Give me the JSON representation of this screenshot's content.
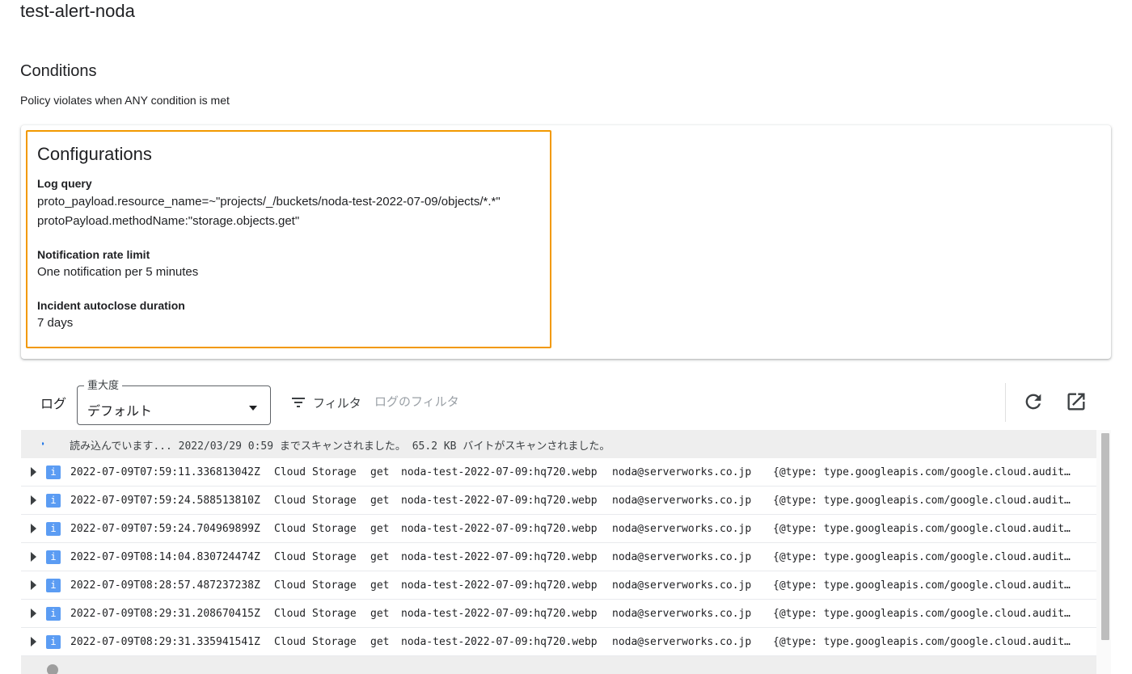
{
  "policy": {
    "title": "test-alert-noda"
  },
  "conditions": {
    "title": "Conditions",
    "description": "Policy violates when ANY condition is met",
    "config": {
      "heading": "Configurations",
      "log_query_label": "Log query",
      "log_query_line1": "proto_payload.resource_name=~\"projects/_/buckets/noda-test-2022-07-09/objects/*.*\"",
      "log_query_line2": "protoPayload.methodName:\"storage.objects.get\"",
      "rate_label": "Notification rate limit",
      "rate_value": "One notification per 5 minutes",
      "autoclose_label": "Incident autoclose duration",
      "autoclose_value": "7 days"
    }
  },
  "log_panel": {
    "label": "ログ",
    "severity_legend": "重大度",
    "severity_value": "デフォルト",
    "filter_label": "フィルタ",
    "filter_placeholder": "ログのフィルタ",
    "icons": {
      "filter": "filter-icon",
      "refresh": "refresh-icon",
      "open": "open-in-new-icon"
    },
    "loading_text": "読み込んでいます... 2022/03/29 0:59 までスキャンされました。 65.2 KB バイトがスキャンされました。",
    "rows": [
      {
        "severity": "i",
        "timestamp": "2022-07-09T07:59:11.336813042Z",
        "resource": "Cloud Storage",
        "method": "get",
        "object": "noda-test-2022-07-09:hq720.webp",
        "user": "noda@serverworks.co.jp",
        "payload": "{@type: type.googleapis.com/google.cloud.audit.AuditLog}"
      },
      {
        "severity": "i",
        "timestamp": "2022-07-09T07:59:24.588513810Z",
        "resource": "Cloud Storage",
        "method": "get",
        "object": "noda-test-2022-07-09:hq720.webp",
        "user": "noda@serverworks.co.jp",
        "payload": "{@type: type.googleapis.com/google.cloud.audit.AuditLog}"
      },
      {
        "severity": "i",
        "timestamp": "2022-07-09T07:59:24.704969899Z",
        "resource": "Cloud Storage",
        "method": "get",
        "object": "noda-test-2022-07-09:hq720.webp",
        "user": "noda@serverworks.co.jp",
        "payload": "{@type: type.googleapis.com/google.cloud.audit.AuditLog}"
      },
      {
        "severity": "i",
        "timestamp": "2022-07-09T08:14:04.830724474Z",
        "resource": "Cloud Storage",
        "method": "get",
        "object": "noda-test-2022-07-09:hq720.webp",
        "user": "noda@serverworks.co.jp",
        "payload": "{@type: type.googleapis.com/google.cloud.audit.AuditLog}"
      },
      {
        "severity": "i",
        "timestamp": "2022-07-09T08:28:57.487237238Z",
        "resource": "Cloud Storage",
        "method": "get",
        "object": "noda-test-2022-07-09:hq720.webp",
        "user": "noda@serverworks.co.jp",
        "payload": "{@type: type.googleapis.com/google.cloud.audit.AuditLog}"
      },
      {
        "severity": "i",
        "timestamp": "2022-07-09T08:29:31.208670415Z",
        "resource": "Cloud Storage",
        "method": "get",
        "object": "noda-test-2022-07-09:hq720.webp",
        "user": "noda@serverworks.co.jp",
        "payload": "{@type: type.googleapis.com/google.cloud.audit.AuditLog}"
      },
      {
        "severity": "i",
        "timestamp": "2022-07-09T08:29:31.335941541Z",
        "resource": "Cloud Storage",
        "method": "get",
        "object": "noda-test-2022-07-09:hq720.webp",
        "user": "noda@serverworks.co.jp",
        "payload": "{@type: type.googleapis.com/google.cloud.audit.AuditLog}"
      }
    ]
  },
  "colors": {
    "highlight_border": "#f29900",
    "info_badge": "#5b9cf3"
  }
}
